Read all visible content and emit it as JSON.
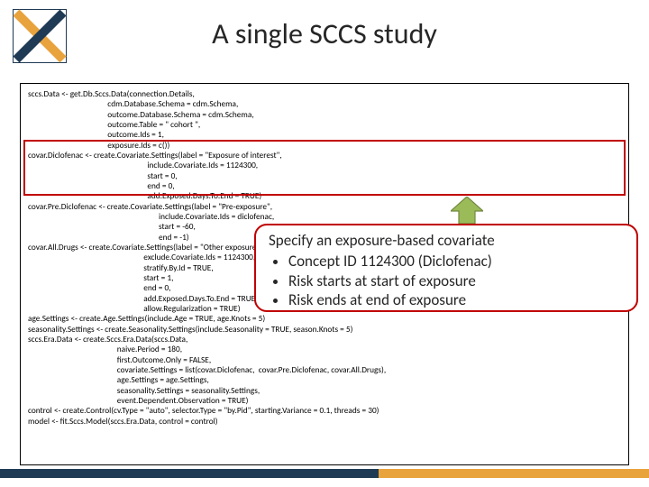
{
  "title": "A single SCCS study",
  "code": "sccs.Data <- get.Db.Sccs.Data(connection.Details,\n                                          cdm.Database.Schema = cdm.Schema,\n                                          outcome.Database.Schema = cdm.Schema,\n                                          outcome.Table = \" cohort \",\n                                          outcome.Ids = 1,\n                                          exposure.Ids = c())\ncovar.Diclofenac <- create.Covariate.Settings(label = \"Exposure of interest\",\n                                                               include.Covariate.Ids = 1124300,\n                                                               start = 0,\n                                                               end = 0,\n                                                               add.Exposed.Days.To.End = TRUE)\ncovar.Pre.Diclofenac <- create.Covariate.Settings(label = \"Pre-exposure\",\n                                                                     include.Covariate.Ids = diclofenac,\n                                                                     start = -60,\n                                                                     end = -1)\ncovar.All.Drugs <- create.Covariate.Settings(label = \"Other exposures\",\n                                                             exclude.Covariate.Ids = 1124300,\n                                                             stratify.By.Id = TRUE,\n                                                             start = 1,\n                                                             end = 0,\n                                                             add.Exposed.Days.To.End = TRUE,\n                                                             allow.Regularization = TRUE)\nage.Settings <- create.Age.Settings(include.Age = TRUE, age.Knots = 5)\nseasonality.Settings <- create.Seasonality.Settings(include.Seasonality = TRUE, season.Knots = 5)\nsccs.Era.Data <- create.Sccs.Era.Data(sccs.Data,\n                                               naive.Period = 180,\n                                               first.Outcome.Only = FALSE,\n                                               covariate.Settings = list(covar.Diclofenac,  covar.Pre.Diclofenac, covar.All.Drugs),\n                                               age.Settings = age.Settings,\n                                               seasonality.Settings = seasonality.Settings,\n                                               event.Dependent.Observation = TRUE)\ncontrol <- create.Control(cv.Type = \"auto\", selector.Type = \"by.Pid\", starting.Variance = 0.1, threads = 30)\nmodel <- fit.Sccs.Model(sccs.Era.Data, control = control)",
  "callout": {
    "title": "Specify an exposure-based covariate",
    "b1": "Concept ID 1124300  (Diclofenac)",
    "b2": "Risk starts at start of exposure",
    "b3": "Risk ends at end of exposure"
  },
  "colors": {
    "accent_red": "#c00000",
    "brand_blue": "#1f3a55",
    "brand_gold": "#e8a33d"
  }
}
